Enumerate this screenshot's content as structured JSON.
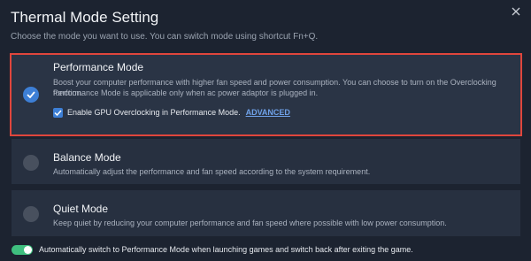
{
  "window": {
    "title": "Thermal Mode Setting",
    "subtitle": "Choose the mode you want to use. You can switch mode using shortcut Fn+Q."
  },
  "modes": [
    {
      "name": "Performance Mode",
      "description_line1": "Boost your computer performance with higher fan speed and power consumption. You can choose to turn on the Overclocking function.",
      "description_line2": "Performance Mode is applicable only when ac power adaptor is plugged in.",
      "selected": true
    },
    {
      "name": "Balance Mode",
      "description_line1": "Automatically adjust the performance and fan speed according to the system requirement.",
      "selected": false
    },
    {
      "name": "Quiet Mode",
      "description_line1": "Keep quiet by reducing your computer performance and fan speed where possible with low power consumption.",
      "selected": false
    }
  ],
  "gpu_overclock": {
    "label": "Enable GPU Overclocking in Performance Mode.",
    "checked": true,
    "advanced_link": "ADVANCED"
  },
  "auto_switch": {
    "label": "Automatically switch to Performance Mode when launching games and switch back after exiting the game.",
    "enabled": true
  },
  "colors": {
    "accent": "#3d7fd6",
    "selection_border": "#e0463c",
    "toggle_on": "#3fbf7f"
  },
  "icons": {
    "close": "close-icon",
    "check": "checkmark-icon"
  }
}
